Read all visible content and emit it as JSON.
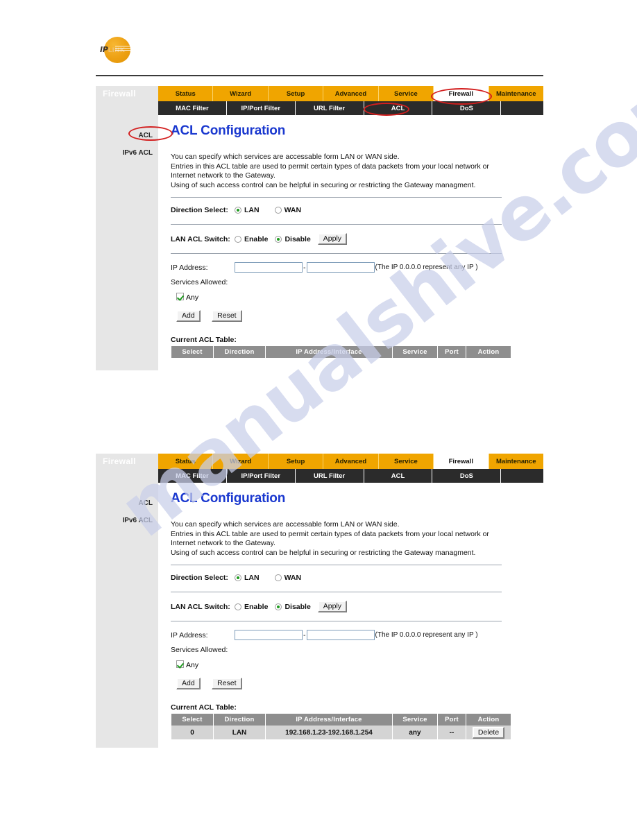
{
  "watermark": {
    "text": "manualshive.com"
  },
  "logo": {
    "ip": "IP",
    "link": "LINK"
  },
  "panels": [
    {
      "sidebar_header": "Firewall",
      "nav_tabs": [
        {
          "label": "Status",
          "active": false
        },
        {
          "label": "Wizard",
          "active": false
        },
        {
          "label": "Setup",
          "active": false
        },
        {
          "label": "Advanced",
          "active": false
        },
        {
          "label": "Service",
          "active": false
        },
        {
          "label": "Firewall",
          "active": true
        },
        {
          "label": "Maintenance",
          "active": false
        }
      ],
      "sub_tabs": [
        {
          "label": "MAC Filter"
        },
        {
          "label": "IP/Port Filter"
        },
        {
          "label": "URL Filter"
        },
        {
          "label": "ACL"
        },
        {
          "label": "DoS"
        },
        {
          "label": ""
        }
      ],
      "sidebar_items": [
        {
          "label": "ACL"
        },
        {
          "label": "IPv6 ACL"
        }
      ],
      "title": "ACL Configuration",
      "description": [
        "You can specify which services are accessable form LAN or WAN side.",
        "Entries in this ACL table are used to permit certain types of data packets from your local network or",
        "Internet network to the Gateway.",
        "Using of such access control can be helpful in securing or restricting the Gateway managment."
      ],
      "direction_select": {
        "label": "Direction Select:",
        "options": [
          {
            "label": "LAN",
            "selected": true
          },
          {
            "label": "WAN",
            "selected": false
          }
        ]
      },
      "lan_acl_switch": {
        "label": "LAN ACL Switch:",
        "options": [
          {
            "label": "Enable",
            "selected": false
          },
          {
            "label": "Disable",
            "selected": true
          }
        ],
        "apply_label": "Apply"
      },
      "ip_address": {
        "label": "IP Address:",
        "start_value": "",
        "end_value": "",
        "separator": "-",
        "hint": "(The IP 0.0.0.0 represent any IP )"
      },
      "services_allowed": {
        "label": "Services Allowed:",
        "any_label": "Any",
        "any_checked": true
      },
      "buttons": {
        "add_label": "Add",
        "reset_label": "Reset"
      },
      "table": {
        "caption": "Current ACL Table:",
        "headers": [
          "Select",
          "Direction",
          "IP Address/Interface",
          "Service",
          "Port",
          "Action"
        ],
        "rows": []
      },
      "annotations": [
        {
          "target": "nav-tab-firewall"
        },
        {
          "target": "sub-tab-acl"
        },
        {
          "target": "sidebar-item-acl"
        }
      ]
    },
    {
      "sidebar_header": "Firewall",
      "nav_tabs": [
        {
          "label": "Status",
          "active": false
        },
        {
          "label": "Wizard",
          "active": false
        },
        {
          "label": "Setup",
          "active": false
        },
        {
          "label": "Advanced",
          "active": false
        },
        {
          "label": "Service",
          "active": false
        },
        {
          "label": "Firewall",
          "active": true
        },
        {
          "label": "Maintenance",
          "active": false
        }
      ],
      "sub_tabs": [
        {
          "label": "MAC Filter"
        },
        {
          "label": "IP/Port Filter"
        },
        {
          "label": "URL Filter"
        },
        {
          "label": "ACL"
        },
        {
          "label": "DoS"
        },
        {
          "label": ""
        }
      ],
      "sidebar_items": [
        {
          "label": "ACL"
        },
        {
          "label": "IPv6 ACL"
        }
      ],
      "title": "ACL Configuration",
      "description": [
        "You can specify which services are accessable form LAN or WAN side.",
        "Entries in this ACL table are used to permit certain types of data packets from your local network or",
        "Internet network to the Gateway.",
        "Using of such access control can be helpful in securing or restricting the Gateway managment."
      ],
      "direction_select": {
        "label": "Direction Select:",
        "options": [
          {
            "label": "LAN",
            "selected": true
          },
          {
            "label": "WAN",
            "selected": false
          }
        ]
      },
      "lan_acl_switch": {
        "label": "LAN ACL Switch:",
        "options": [
          {
            "label": "Enable",
            "selected": false
          },
          {
            "label": "Disable",
            "selected": true
          }
        ],
        "apply_label": "Apply"
      },
      "ip_address": {
        "label": "IP Address:",
        "start_value": "",
        "end_value": "",
        "separator": "-",
        "hint": "(The IP 0.0.0.0 represent any IP )"
      },
      "services_allowed": {
        "label": "Services Allowed:",
        "any_label": "Any",
        "any_checked": true
      },
      "buttons": {
        "add_label": "Add",
        "reset_label": "Reset"
      },
      "table": {
        "caption": "Current ACL Table:",
        "headers": [
          "Select",
          "Direction",
          "IP Address/Interface",
          "Service",
          "Port",
          "Action"
        ],
        "rows": [
          {
            "select": "0",
            "direction": "LAN",
            "ip_address": "192.168.1.23-192.168.1.254",
            "service": "any",
            "port": "--",
            "action_label": "Delete"
          }
        ]
      },
      "annotations": []
    }
  ],
  "colors": {
    "nav_orange": "#f0a500",
    "subnav_dark": "#2b2b2b",
    "title_blue": "#1a38cf",
    "sidebar_gray": "#e6e6e6",
    "table_header_gray": "#8e8e8e",
    "table_cell_gray": "#d4d4d4",
    "annotation_red": "#d31f1f",
    "radio_green": "#1f9b1f"
  }
}
